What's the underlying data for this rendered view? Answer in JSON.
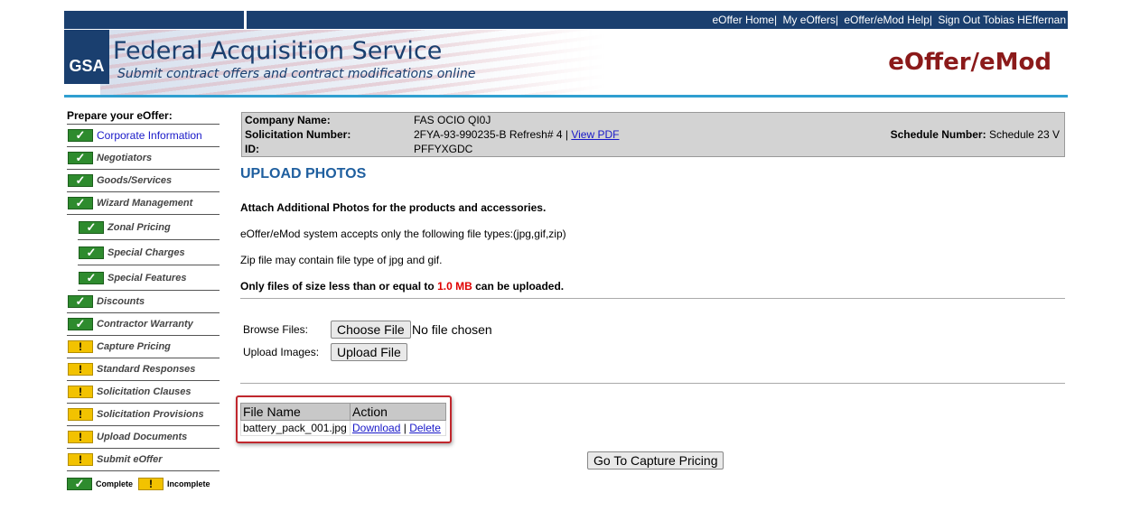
{
  "nav": {
    "links": [
      "eOffer Home",
      "My eOffers",
      "eOffer/eMod Help",
      "Sign Out Tobias HEffernan"
    ]
  },
  "header": {
    "logo_text": "GSA",
    "title": "Federal Acquisition Service",
    "subtitle": "Submit contract offers and contract modifications online",
    "app_name": "eOffer/eMod"
  },
  "sidebar": {
    "title": "Prepare your eOffer:",
    "items": [
      {
        "label": "Corporate Information",
        "status": "complete"
      },
      {
        "label": "Negotiators",
        "status": "complete"
      },
      {
        "label": "Goods/Services",
        "status": "complete"
      },
      {
        "label": "Wizard Management",
        "status": "complete"
      },
      {
        "label": "Zonal Pricing",
        "status": "complete"
      },
      {
        "label": "Special Charges",
        "status": "complete"
      },
      {
        "label": "Special Features",
        "status": "complete"
      },
      {
        "label": "Discounts",
        "status": "complete"
      },
      {
        "label": "Contractor Warranty",
        "status": "complete"
      },
      {
        "label": "Capture Pricing",
        "status": "incomplete"
      },
      {
        "label": "Standard Responses",
        "status": "incomplete"
      },
      {
        "label": "Solicitation Clauses",
        "status": "incomplete"
      },
      {
        "label": "Solicitation Provisions",
        "status": "incomplete"
      },
      {
        "label": "Upload Documents",
        "status": "incomplete"
      },
      {
        "label": "Submit eOffer",
        "status": "incomplete"
      }
    ],
    "legend": {
      "complete": "Complete",
      "incomplete": "Incomplete"
    }
  },
  "info": {
    "company_label": "Company Name:",
    "company_value": "FAS OCIO QI0J",
    "solicitation_label": "Solicitation Number:",
    "solicitation_value": "2FYA-93-990235-B Refresh# 4 |",
    "view_pdf": "View PDF",
    "id_label": "ID:",
    "id_value": "PFFYXGDC",
    "schedule_label": "Schedule Number:",
    "schedule_value": "Schedule 23 V"
  },
  "main": {
    "title": "UPLOAD PHOTOS",
    "intro": "Attach Additional Photos for the products and accessories.",
    "accepts": "eOffer/eMod system accepts only the following file types:(jpg,gif,zip)",
    "zip_note": "Zip file may contain file type of jpg and gif.",
    "size_prefix": "Only files of size less than or equal to",
    "size_value": "1.0 MB",
    "size_suffix": "can be uploaded.",
    "browse_label": "Browse Files:",
    "choose_file": "Choose File",
    "no_file": "No file chosen",
    "upload_label": "Upload Images:",
    "upload_button": "Upload File",
    "table": {
      "headers": [
        "File Name",
        "Action"
      ],
      "rows": [
        {
          "file": "battery_pack_001.jpg",
          "download": "Download",
          "sep": "|",
          "delete": "Delete"
        }
      ]
    },
    "next_button": "Go To Capture Pricing"
  }
}
